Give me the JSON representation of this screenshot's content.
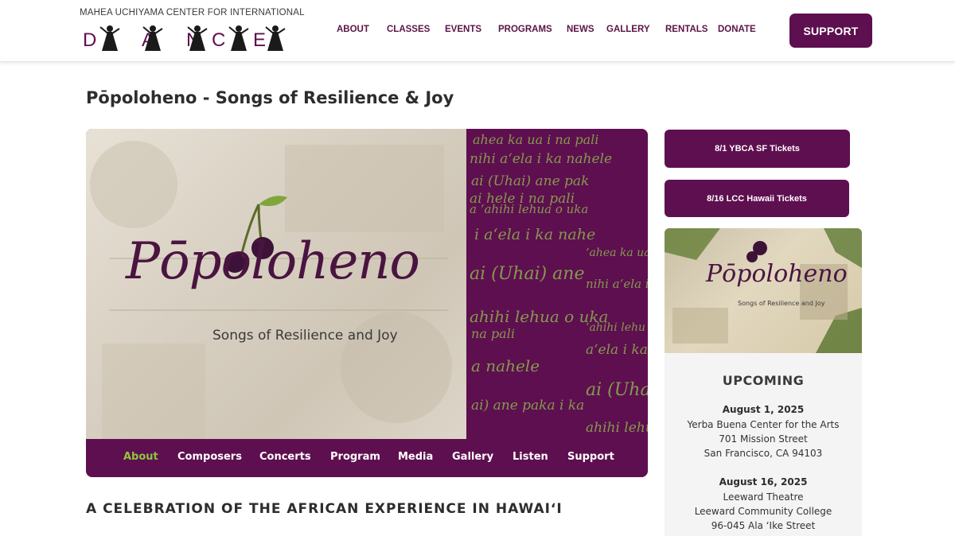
{
  "brand": {
    "logo_top": "MAHEA UCHIYAMA CENTER FOR INTERNATIONAL",
    "logo_letters": [
      "D",
      "A",
      "N",
      "C",
      "E"
    ],
    "accent": "#5e0f4f",
    "highlight": "#8dc63f"
  },
  "nav": {
    "items": [
      "ABOUT",
      "CLASSES",
      "EVENTS",
      "PROGRAMS",
      "NEWS",
      "GALLERY",
      "RENTALS",
      "DONATE"
    ],
    "support_label": "SUPPORT"
  },
  "page": {
    "title": "Pōpoloheno - Songs of Resilience & Joy",
    "section_heading": "A CELEBRATION OF THE AFRICAN EXPERIENCE IN HAWAIʻI"
  },
  "hero": {
    "logo_text": "Pōpoloheno",
    "subtitle": "Songs of Resilience and Joy",
    "script_lines": [
      "ahea ka ua i na pali",
      "nihi aʻela i ka nahele",
      "ai (Uhai) ane pak",
      "ai hele i na pali",
      "a ʻahihi lehua o uka",
      "i aʻela i ka nahe",
      "ʻahea ka ua i",
      "ai (Uhai) ane",
      "nihi aʻela i ka",
      "ahihi lehua o uka",
      "ʻahihi lehu",
      "na pali",
      "aʻela i ka",
      "a nahele",
      "ai (Uhai",
      "ai) ane paka i ka",
      "ahihi lehu"
    ],
    "tabs": [
      "About",
      "Composers",
      "Concerts",
      "Program",
      "Media",
      "Gallery",
      "Listen",
      "Support"
    ],
    "active_tab": "About"
  },
  "sidebar": {
    "ticket_1": "8/1 YBCA SF Tickets",
    "ticket_2": "8/16 LCC Hawaii Tickets",
    "card_logo_text": "Pōpoloheno",
    "card_subtitle": "Songs of Resilience and Joy",
    "upcoming_label": "UPCOMING",
    "events": [
      {
        "date": "August 1, 2025",
        "lines": [
          "Yerba Buena Center for the Arts",
          "701 Mission Street",
          "San Francisco, CA 94103"
        ]
      },
      {
        "date": "August 16, 2025",
        "lines": [
          "Leeward Theatre",
          "Leeward Community College",
          "96-045 Ala ʻIke Street"
        ]
      }
    ]
  }
}
